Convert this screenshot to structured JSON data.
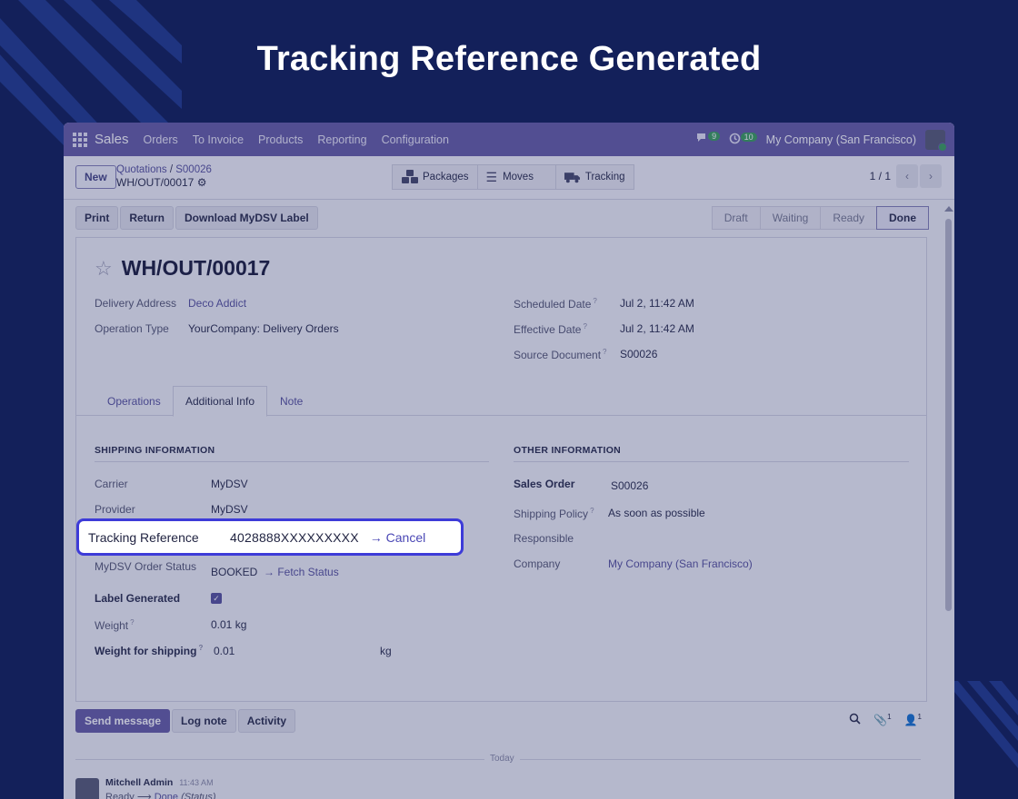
{
  "headline": "Tracking Reference Generated",
  "navbar": {
    "brand": "Sales",
    "menu": [
      "Orders",
      "To Invoice",
      "Products",
      "Reporting",
      "Configuration"
    ],
    "messages_badge": "9",
    "activities_badge": "10",
    "company": "My Company (San Francisco)"
  },
  "control": {
    "new_label": "New",
    "breadcrumb_parent": "Quotations",
    "breadcrumb_separator": "/",
    "breadcrumb_order": "S00026",
    "current_record": "WH/OUT/00017",
    "smart_buttons": [
      "Packages",
      "Moves",
      "Tracking"
    ],
    "pager": "1 / 1"
  },
  "actions": [
    "Print",
    "Return",
    "Download MyDSV Label"
  ],
  "statusbar": [
    "Draft",
    "Waiting",
    "Ready",
    "Done"
  ],
  "record": {
    "title": "WH/OUT/00017",
    "left_fields": [
      {
        "label": "Delivery Address",
        "value": "Deco Addict"
      },
      {
        "label": "Operation Type",
        "value": "YourCompany: Delivery Orders"
      }
    ],
    "right_fields": [
      {
        "label": "Scheduled Date",
        "value": "Jul 2, 11:42 AM"
      },
      {
        "label": "Effective Date",
        "value": "Jul 2, 11:42 AM"
      },
      {
        "label": "Source Document",
        "value": "S00026"
      }
    ],
    "help_mark": "?"
  },
  "tabs": [
    "Operations",
    "Additional Info",
    "Note"
  ],
  "shipping": {
    "title": "SHIPPING INFORMATION",
    "carrier_label": "Carrier",
    "carrier_value": "MyDSV",
    "provider_label": "Provider",
    "provider_value": "MyDSV",
    "order_status_label": "MyDSV Order Status",
    "order_status_value": "BOOKED",
    "fetch_status": "→ Fetch Status",
    "label_generated_label": "Label Generated",
    "label_generated_checked": true,
    "weight_label": "Weight",
    "weight_value": "0.01 kg",
    "weight_shipping_label": "Weight for shipping",
    "weight_shipping_value": "0.01",
    "weight_shipping_unit": "kg"
  },
  "other": {
    "title": "OTHER INFORMATION",
    "sales_order_label": "Sales Order",
    "sales_order_value": "S00026",
    "shipping_policy_label": "Shipping Policy",
    "shipping_policy_value": "As soon as possible",
    "responsible_label": "Responsible",
    "company_label": "Company",
    "company_value": "My Company (San Francisco)"
  },
  "tracking": {
    "label": "Tracking Reference",
    "value": "4028888XXXXXXXXX",
    "cancel": "→ Cancel"
  },
  "chatter": {
    "buttons": [
      "Send message",
      "Log note",
      "Activity"
    ],
    "attachments_count": "1",
    "followers_count": "1",
    "date_separator": "Today",
    "author": "Mitchell Admin",
    "time": "11:43 AM",
    "from_state": "Ready",
    "to_state": "Done",
    "field": "(Status)"
  }
}
